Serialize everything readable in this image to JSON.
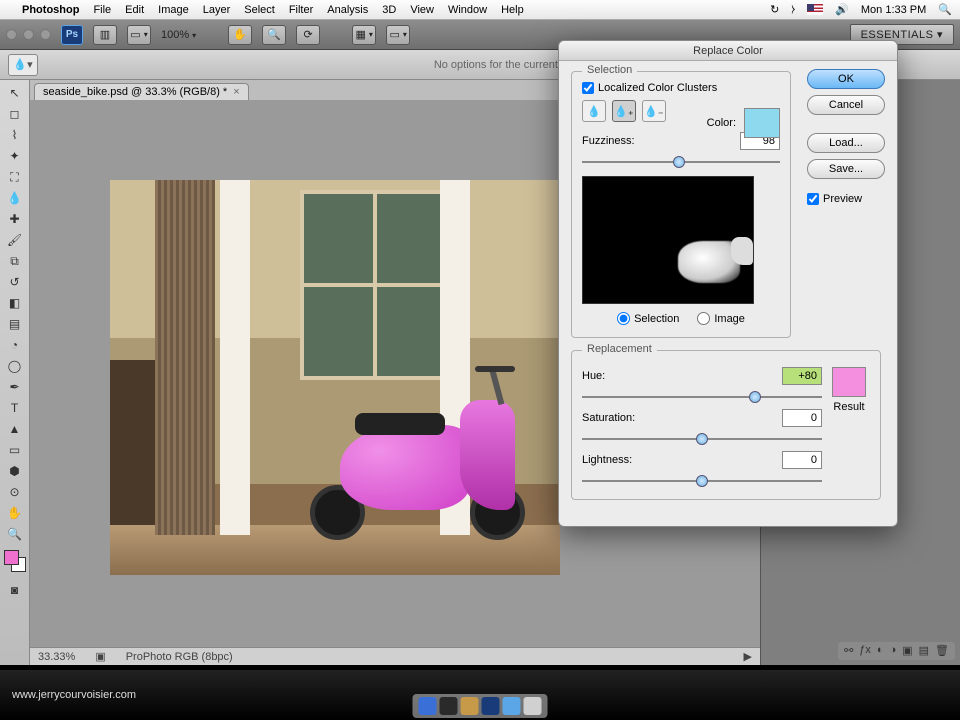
{
  "menubar": {
    "app": "Photoshop",
    "items": [
      "File",
      "Edit",
      "Image",
      "Layer",
      "Select",
      "Filter",
      "Analysis",
      "3D",
      "View",
      "Window",
      "Help"
    ],
    "clock": "Mon 1:33 PM"
  },
  "optbar": {
    "zoom": "100%",
    "essentials": "ESSENTIALS ▾"
  },
  "tooloptions": {
    "msg": "No options for the current to"
  },
  "document": {
    "tab": "seaside_bike.psd @ 33.3% (RGB/8) *",
    "status_zoom": "33.33%",
    "status_profile": "ProPhoto RGB (8bpc)"
  },
  "dialog": {
    "title": "Replace Color",
    "ok": "OK",
    "cancel": "Cancel",
    "load": "Load...",
    "save": "Save...",
    "preview": "Preview",
    "selection": {
      "legend": "Selection",
      "localized": "Localized Color Clusters",
      "color_label": "Color:",
      "color_swatch": "#8fd9ef",
      "fuzziness_label": "Fuzziness:",
      "fuzziness": "98",
      "fuzziness_pct": 49,
      "radio_selection": "Selection",
      "radio_image": "Image",
      "radio_value": "selection"
    },
    "replacement": {
      "legend": "Replacement",
      "hue_label": "Hue:",
      "hue": "+80",
      "hue_pct": 72,
      "sat_label": "Saturation:",
      "sat": "0",
      "sat_pct": 50,
      "light_label": "Lightness:",
      "light": "0",
      "light_pct": 50,
      "result_label": "Result",
      "result_swatch": "#f48fe0"
    }
  },
  "footer": {
    "url": "www.jerrycourvoisier.com"
  }
}
